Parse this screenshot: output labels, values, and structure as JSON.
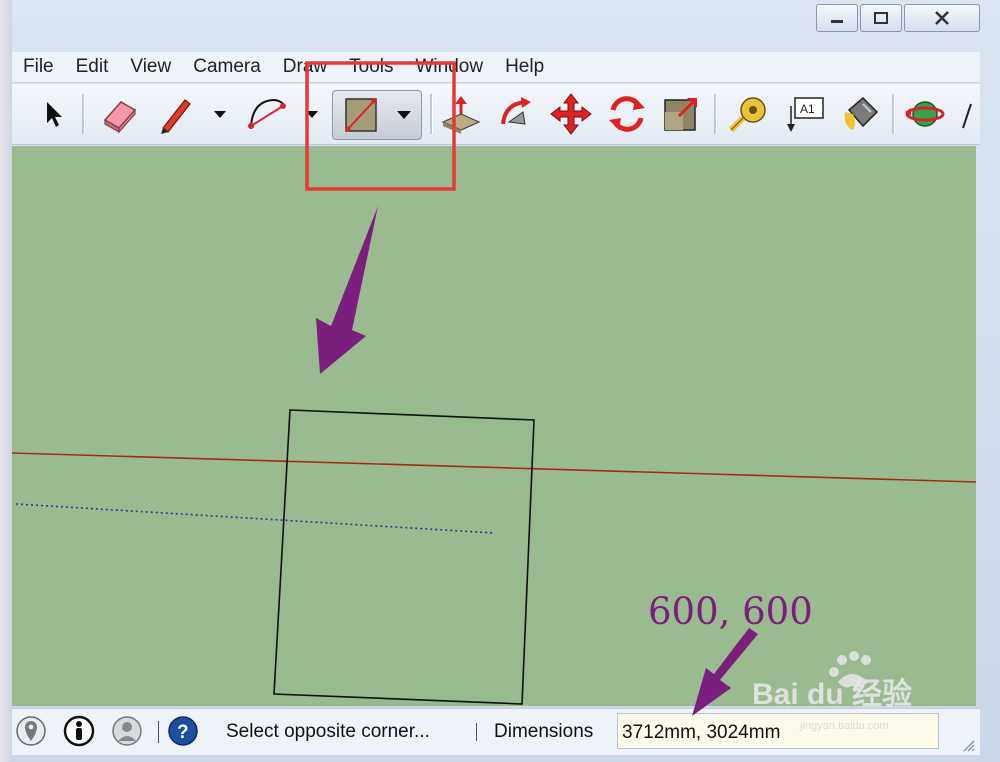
{
  "menubar": {
    "items": [
      "File",
      "Edit",
      "View",
      "Camera",
      "Draw",
      "Tools",
      "Window",
      "Help"
    ]
  },
  "toolbar": {
    "tools": [
      {
        "name": "select-tool",
        "icon": "arrow-cursor-icon"
      },
      {
        "name": "eraser-tool",
        "icon": "eraser-icon"
      },
      {
        "name": "pencil-tool",
        "icon": "pencil-icon"
      },
      {
        "name": "arc-tool",
        "icon": "arc-icon"
      },
      {
        "name": "rectangle-tool",
        "icon": "rectangle-icon",
        "active": true
      },
      {
        "name": "push-pull-tool",
        "icon": "push-pull-icon"
      },
      {
        "name": "follow-me-tool",
        "icon": "follow-me-icon"
      },
      {
        "name": "move-tool",
        "icon": "move-icon"
      },
      {
        "name": "rotate-tool",
        "icon": "rotate-icon"
      },
      {
        "name": "scale-tool",
        "icon": "scale-icon"
      },
      {
        "name": "tape-measure-tool",
        "icon": "tape-measure-icon"
      },
      {
        "name": "text-tool",
        "icon": "text-label-icon",
        "label": "A1"
      },
      {
        "name": "paint-bucket-tool",
        "icon": "paint-bucket-icon"
      },
      {
        "name": "orbit-tool",
        "icon": "orbit-icon"
      }
    ]
  },
  "statusbar": {
    "message": "Select opposite corner...",
    "vcb_label": "Dimensions",
    "vcb_value": "3712mm, 3024mm"
  },
  "annotation": {
    "text": "600, 600",
    "color": "#7b1f7e"
  },
  "colors": {
    "viewport_bg": "#99bb8f",
    "red_axis": "#a52a1a",
    "blue_axis": "#1f3f9e",
    "highlight_box": "#e53935",
    "arrow": "#7b1f7e"
  },
  "watermark": {
    "text": "Bai du 经验",
    "url": "jingyan.baidu.com"
  }
}
